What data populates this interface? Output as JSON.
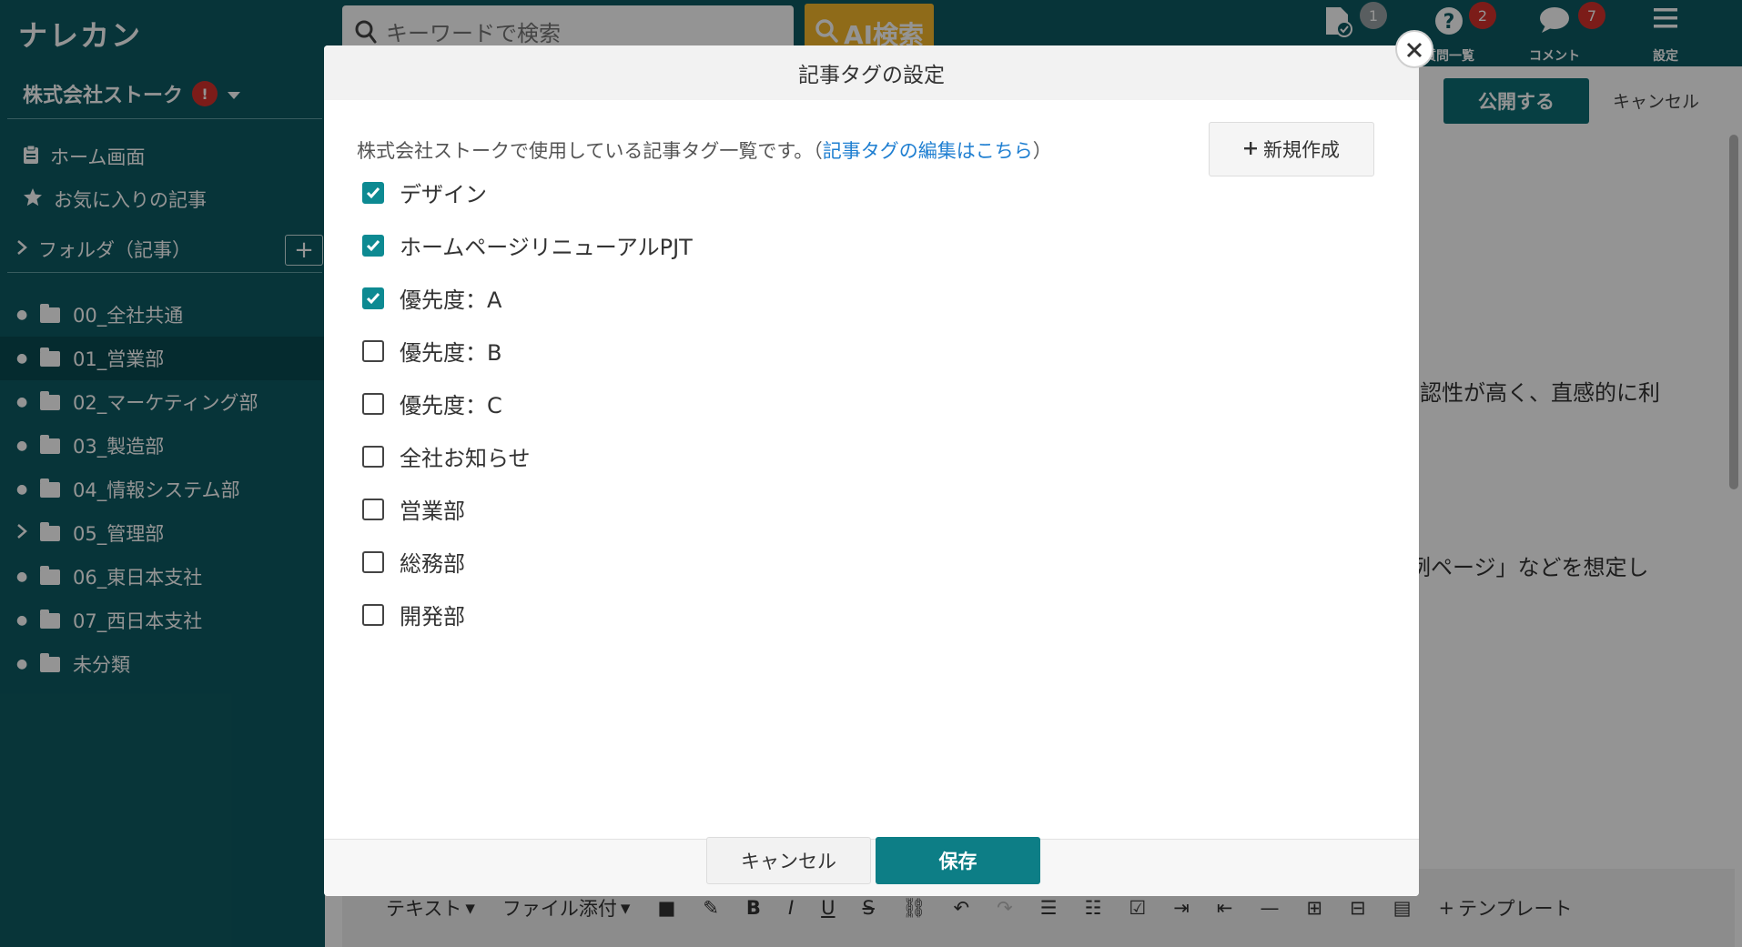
{
  "app": {
    "logo": "ナレカン",
    "search_placeholder": "キーワードで検索",
    "ai_search_label": "AI検索",
    "header_icons": [
      {
        "name": "approval",
        "label": "",
        "badge": "1"
      },
      {
        "name": "question",
        "label": "質問一覧",
        "badge": "2"
      },
      {
        "name": "comment",
        "label": "コメント",
        "badge": "7"
      },
      {
        "name": "settings",
        "label": "設定",
        "badge": ""
      }
    ]
  },
  "sidebar": {
    "company": "株式会社ストーク",
    "company_alert": "!",
    "nav": [
      {
        "label": "ホーム画面"
      },
      {
        "label": "お気に入りの記事"
      }
    ],
    "folder_heading": "フォルダ（記事）",
    "add_folder": "+",
    "folders": [
      {
        "label": "00_全社共通",
        "expandable": false
      },
      {
        "label": "01_営業部",
        "expandable": false
      },
      {
        "label": "02_マーケティング部",
        "expandable": false
      },
      {
        "label": "03_製造部",
        "expandable": false
      },
      {
        "label": "04_情報システム部",
        "expandable": false
      },
      {
        "label": "05_管理部",
        "expandable": true
      },
      {
        "label": "06_東日本支社",
        "expandable": false
      },
      {
        "label": "07_西日本支社",
        "expandable": false
      },
      {
        "label": "未分類",
        "expandable": false
      }
    ]
  },
  "editor": {
    "publish_label": "公開する",
    "cancel_label": "キャンセル",
    "text_fragment_1": "認性が高く、直感的に利",
    "text_fragment_2": "例ページ」などを想定し",
    "toolbar": {
      "text_label": "テキスト",
      "attach_label": "ファイル添付",
      "template_label": "テンプレート"
    }
  },
  "modal": {
    "title": "記事タグの設定",
    "intro_text": "株式会社ストークで使用している記事タグ一覧です。（",
    "intro_link": "記事タグの編集はこちら",
    "intro_close": "）",
    "new_button": "新規作成",
    "tags": [
      {
        "label": "デザイン",
        "checked": true
      },
      {
        "label": "ホームページリニューアルPJT",
        "checked": true
      },
      {
        "label": "優先度：A",
        "checked": true
      },
      {
        "label": "優先度：B",
        "checked": false
      },
      {
        "label": "優先度：C",
        "checked": false
      },
      {
        "label": "全社お知らせ",
        "checked": false
      },
      {
        "label": "営業部",
        "checked": false
      },
      {
        "label": "総務部",
        "checked": false
      },
      {
        "label": "開発部",
        "checked": false
      }
    ],
    "cancel_button": "キャンセル",
    "save_button": "保存"
  },
  "colors": {
    "primary": "#0d5b63",
    "accent": "#0d8a92",
    "ai_button": "#f6b92b",
    "badge": "#d6312c",
    "link": "#1f7fd1"
  }
}
